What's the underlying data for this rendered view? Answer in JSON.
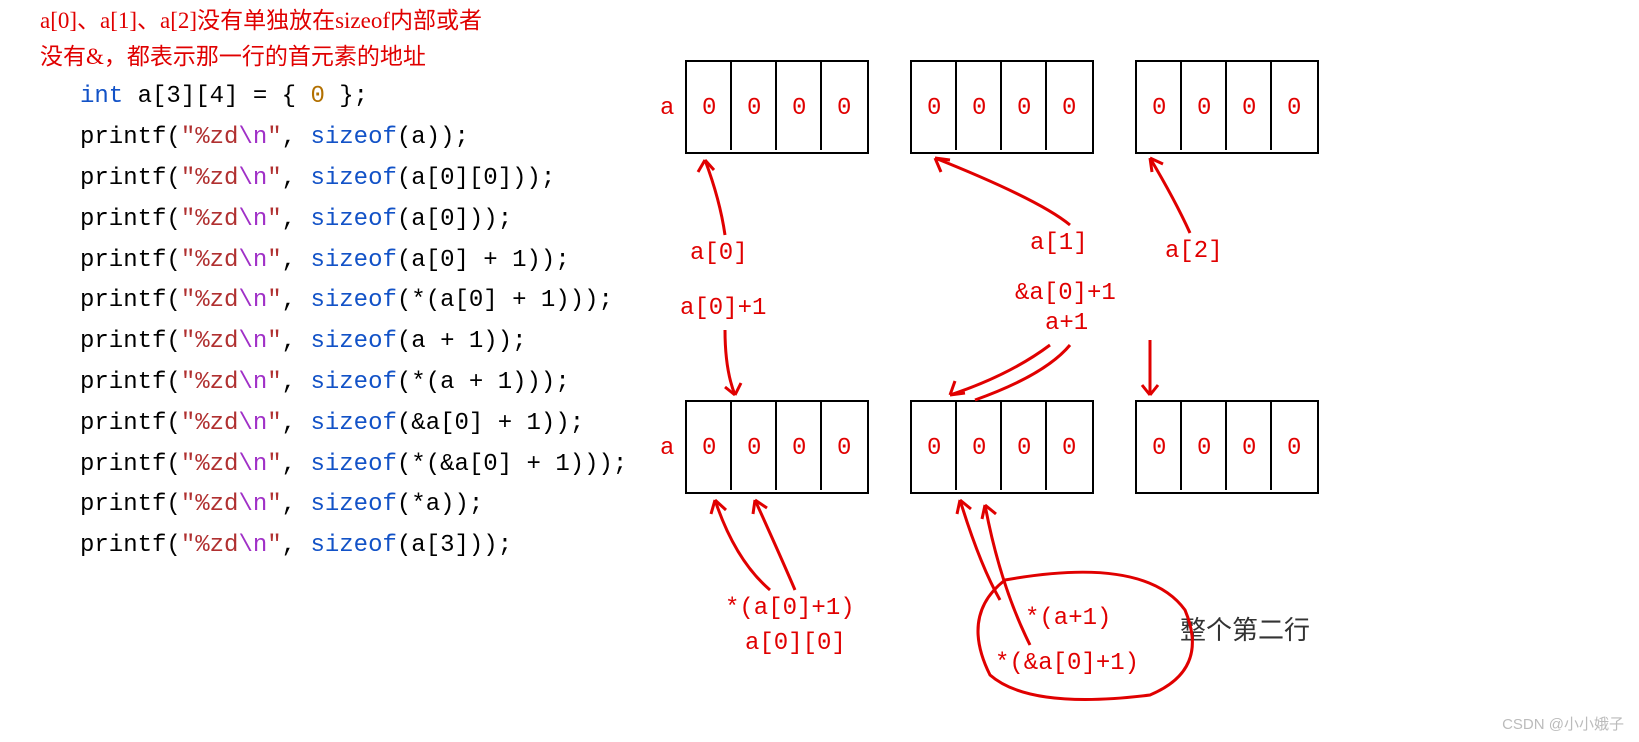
{
  "comment_lines": [
    "a[0]、a[1]、a[2]没有单独放在sizeof内部或者",
    "没有&，都表示那一行的首元素的地址"
  ],
  "code": {
    "decl_kw": "int",
    "decl_rest": " a[3][4] = { ",
    "decl_num": "0",
    "decl_end": " };",
    "lines": [
      {
        "p": "printf",
        "open": "(",
        "q1": "\"",
        "fmt": "%zd",
        "esc": "\\n",
        "q2": "\"",
        "c": ", ",
        "s": "sizeof",
        "arg": "(a)",
        "end": ");"
      },
      {
        "p": "printf",
        "open": "(",
        "q1": "\"",
        "fmt": "%zd",
        "esc": "\\n",
        "q2": "\"",
        "c": ", ",
        "s": "sizeof",
        "arg": "(a[0][0])",
        "end": ");"
      },
      {
        "p": "printf",
        "open": "(",
        "q1": "\"",
        "fmt": "%zd",
        "esc": "\\n",
        "q2": "\"",
        "c": ", ",
        "s": "sizeof",
        "arg": "(a[0])",
        "end": ");"
      },
      {
        "p": "printf",
        "open": "(",
        "q1": "\"",
        "fmt": "%zd",
        "esc": "\\n",
        "q2": "\"",
        "c": ", ",
        "s": "sizeof",
        "arg": "(a[0] + 1)",
        "end": ");"
      },
      {
        "p": "printf",
        "open": "(",
        "q1": "\"",
        "fmt": "%zd",
        "esc": "\\n",
        "q2": "\"",
        "c": ", ",
        "s": "sizeof",
        "arg": "(*(a[0] + 1))",
        "end": ");"
      },
      {
        "p": "printf",
        "open": "(",
        "q1": "\"",
        "fmt": "%zd",
        "esc": "\\n",
        "q2": "\"",
        "c": ", ",
        "s": "sizeof",
        "arg": "(a + 1)",
        "end": ");"
      },
      {
        "p": "printf",
        "open": "(",
        "q1": "\"",
        "fmt": "%zd",
        "esc": "\\n",
        "q2": "\"",
        "c": ", ",
        "s": "sizeof",
        "arg": "(*(a + 1))",
        "end": ");"
      },
      {
        "p": "printf",
        "open": "(",
        "q1": "\"",
        "fmt": "%zd",
        "esc": "\\n",
        "q2": "\"",
        "c": ", ",
        "s": "sizeof",
        "arg": "(&a[0] + 1)",
        "end": ");"
      },
      {
        "p": "printf",
        "open": "(",
        "q1": "\"",
        "fmt": "%zd",
        "esc": "\\n",
        "q2": "\"",
        "c": ", ",
        "s": "sizeof",
        "arg": "(*(&a[0] + 1))",
        "end": ");"
      },
      {
        "p": "printf",
        "open": "(",
        "q1": "\"",
        "fmt": "%zd",
        "esc": "\\n",
        "q2": "\"",
        "c": ", ",
        "s": "sizeof",
        "arg": "(*a)",
        "end": ");"
      },
      {
        "p": "printf",
        "open": "(",
        "q1": "\"",
        "fmt": "%zd",
        "esc": "\\n",
        "q2": "\"",
        "c": ", ",
        "s": "sizeof",
        "arg": "(a[3])",
        "end": ");"
      }
    ]
  },
  "labels": {
    "a": "a",
    "a0": "a[0]",
    "a1": "a[1]",
    "a2": "a[2]",
    "a0p1": "a[0]+1",
    "ampa0p1": "&a[0]+1",
    "ap1": "a+1",
    "star_a0p1": "*(a[0]+1)",
    "a00": "a[0][0]",
    "star_ap1": "*(a+1)",
    "star_amp": "*(&a[0]+1)",
    "row2": "整个第二行"
  },
  "zero": "0",
  "watermark": "CSDN @小小娥子"
}
